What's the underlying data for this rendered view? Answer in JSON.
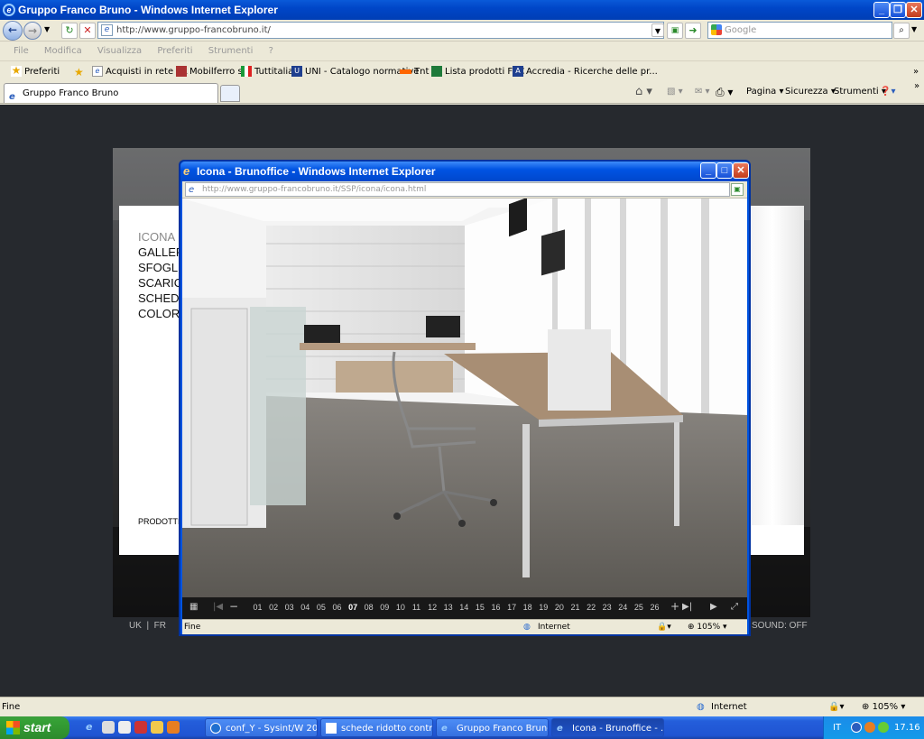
{
  "browser": {
    "title": "Gruppo Franco Bruno - Windows Internet Explorer",
    "address": "http://www.gruppo-francobruno.it/",
    "search_placeholder": "Google",
    "menu": [
      "File",
      "Modifica",
      "Visualizza",
      "Preferiti",
      "Strumenti",
      "?"
    ],
    "favorites_label": "Preferiti",
    "favorites": [
      "Acquisti in rete PA",
      "Mobilferro srl",
      "Tuttitalia",
      "UNI - Catalogo normative",
      "Tnt",
      "Lista prodotti FSC",
      "Accredia - Ricerche delle pr..."
    ],
    "tab_title": "Gruppo Franco Bruno",
    "commands": [
      "Pagina",
      "Sicurezza",
      "Strumenti"
    ],
    "status_left": "Fine",
    "status_zone": "Internet",
    "zoom": "105%"
  },
  "site": {
    "menu": [
      "ICONA",
      "GALLER",
      "SFOGLI",
      "SCARIC",
      "SCHEDA",
      "COLORI"
    ],
    "prodotti": "PRODOTTI",
    "lang": "UK  |  FR",
    "sound": "SOUND: OFF"
  },
  "popup": {
    "title": "Icona - Brunoffice - Windows Internet Explorer",
    "address": "http://www.gruppo-francobruno.it/SSP/icona/icona.html",
    "pages": [
      "01",
      "02",
      "03",
      "04",
      "05",
      "06",
      "07",
      "08",
      "09",
      "10",
      "11",
      "12",
      "13",
      "14",
      "15",
      "16",
      "17",
      "18",
      "19",
      "20",
      "21",
      "22",
      "23",
      "24",
      "25",
      "26"
    ],
    "current_page": "07",
    "status_left": "Fine",
    "status_zone": "Internet",
    "zoom": "105%"
  },
  "taskbar": {
    "start": "start",
    "tasks": [
      "conf_Y - Sysint/W 20...",
      "schede ridotto contro...",
      "Gruppo Franco Bruno...",
      "Icona - Brunoffice - ..."
    ],
    "lang": "IT",
    "time": "17.16"
  }
}
